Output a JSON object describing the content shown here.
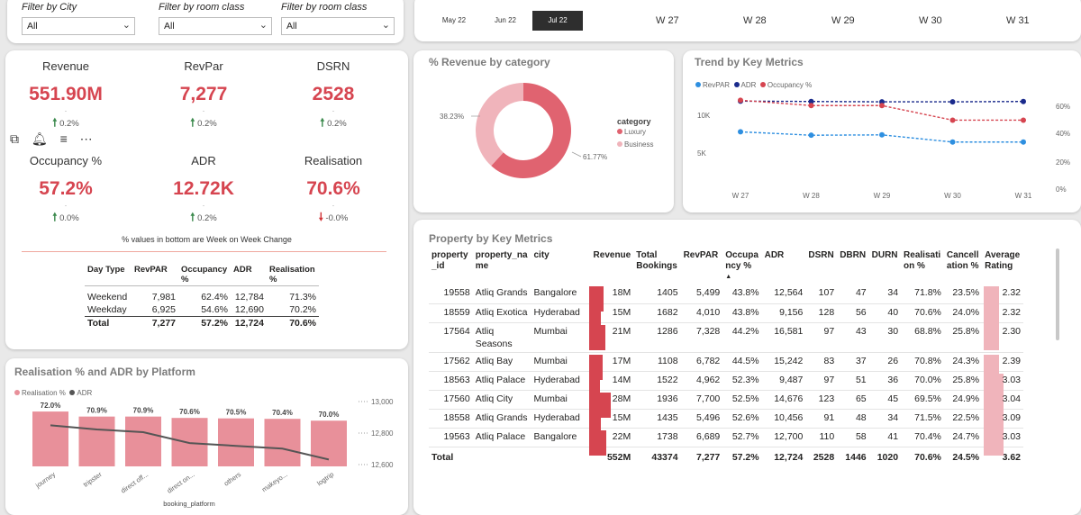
{
  "filters": [
    {
      "label": "Filter by City",
      "value": "All"
    },
    {
      "label": "Filter by room class",
      "value": "All"
    },
    {
      "label": "Filter by room class",
      "value": "All"
    }
  ],
  "date_slicer": {
    "months": [
      "May 22",
      "Jun 22",
      "Jul 22"
    ],
    "selected_month": "Jul 22",
    "weeks": [
      "W 27",
      "W 28",
      "W 29",
      "W 30",
      "W 31"
    ]
  },
  "kpis": [
    {
      "label": "Revenue",
      "value": "551.90M",
      "change": "0.2%",
      "direction": "up"
    },
    {
      "label": "RevPar",
      "value": "7,277",
      "change": "0.2%",
      "direction": "up"
    },
    {
      "label": "DSRN",
      "value": "2528",
      "change": "0.2%",
      "direction": "up"
    },
    {
      "label": "Occupancy %",
      "value": "57.2%",
      "change": "0.0%",
      "direction": "up"
    },
    {
      "label": "ADR",
      "value": "12.72K",
      "change": "0.2%",
      "direction": "up"
    },
    {
      "label": "Realisation",
      "value": "70.6%",
      "change": "-0.0%",
      "direction": "down"
    }
  ],
  "kpi_note": "% values in bottom are Week on Week Change",
  "day_type_table": {
    "headers": [
      "Day Type",
      "RevPAR",
      "Occupancy %",
      "ADR",
      "Realisation %"
    ],
    "rows": [
      [
        "Weekend",
        "7,981",
        "62.4%",
        "12,784",
        "71.3%"
      ],
      [
        "Weekday",
        "6,925",
        "54.6%",
        "12,690",
        "70.2%"
      ]
    ],
    "total": [
      "Total",
      "7,277",
      "57.2%",
      "12,724",
      "70.6%"
    ]
  },
  "revenue_by_category": {
    "title": "% Revenue by category",
    "legend_title": "category",
    "colors": {
      "Luxury": "#e06370",
      "Business": "#f0b4bb"
    }
  },
  "trend": {
    "title": "Trend by Key Metrics",
    "legend": [
      {
        "name": "RevPAR",
        "color": "#2e8fe0"
      },
      {
        "name": "ADR",
        "color": "#1a2a8c"
      },
      {
        "name": "Occupancy %",
        "color": "#d64550"
      }
    ],
    "left_ticks": [
      "10K",
      "5K"
    ],
    "right_ticks": [
      "60%",
      "40%",
      "20%",
      "0%"
    ]
  },
  "platform_chart": {
    "title": "Realisation % and ADR by Platform",
    "legend": [
      {
        "name": "Realisation %",
        "color": "#e8909a"
      },
      {
        "name": "ADR",
        "color": "#555555"
      }
    ],
    "xlabel": "booking_platform",
    "right_ticks": [
      "13,000",
      "12,800",
      "12,600"
    ]
  },
  "property_table": {
    "title": "Property by Key Metrics",
    "headers": [
      "property_id",
      "property_name",
      "city",
      "Revenue",
      "Total Bookings",
      "RevPAR",
      "Occupancy %",
      "ADR",
      "DSRN",
      "DBRN",
      "DURN",
      "Realisation %",
      "Cancellation %",
      "Average Rating"
    ],
    "header_display": [
      "property\n_id",
      "property_na\nme",
      "city",
      "Revenue",
      "Total\nBookings",
      "RevPAR",
      "Occupa\nncy %",
      "ADR",
      "DSRN",
      "DBRN",
      "DURN",
      "Realisati\non %",
      "Cancell\nation %",
      "Average\nRating"
    ],
    "rows": [
      {
        "property_id": "19558",
        "property_name": "Atliq Grands",
        "city": "Bangalore",
        "revenue": "18M",
        "revenue_value": 18,
        "total_bookings": "1405",
        "revpar": "5,499",
        "occupancy": "43.8%",
        "adr": "12,564",
        "dsrn": "107",
        "dbrn": "47",
        "durn": "34",
        "realisation": "71.8%",
        "cancellation": "23.5%",
        "rating": "2.32",
        "rating_value": 2.32
      },
      {
        "property_id": "18559",
        "property_name": "Atliq Exotica",
        "city": "Hyderabad",
        "revenue": "15M",
        "revenue_value": 15,
        "total_bookings": "1682",
        "revpar": "4,010",
        "occupancy": "43.8%",
        "adr": "9,156",
        "dsrn": "128",
        "dbrn": "56",
        "durn": "40",
        "realisation": "70.6%",
        "cancellation": "24.0%",
        "rating": "2.32",
        "rating_value": 2.32
      },
      {
        "property_id": "17564",
        "property_name": "Atliq Seasons",
        "city": "Mumbai",
        "revenue": "21M",
        "revenue_value": 21,
        "total_bookings": "1286",
        "revpar": "7,328",
        "occupancy": "44.2%",
        "adr": "16,581",
        "dsrn": "97",
        "dbrn": "43",
        "durn": "30",
        "realisation": "68.8%",
        "cancellation": "25.8%",
        "rating": "2.30",
        "rating_value": 2.3
      },
      {
        "property_id": "17562",
        "property_name": "Atliq Bay",
        "city": "Mumbai",
        "revenue": "17M",
        "revenue_value": 17,
        "total_bookings": "1108",
        "revpar": "6,782",
        "occupancy": "44.5%",
        "adr": "15,242",
        "dsrn": "83",
        "dbrn": "37",
        "durn": "26",
        "realisation": "70.8%",
        "cancellation": "24.3%",
        "rating": "2.39",
        "rating_value": 2.39
      },
      {
        "property_id": "18563",
        "property_name": "Atliq Palace",
        "city": "Hyderabad",
        "revenue": "14M",
        "revenue_value": 14,
        "total_bookings": "1522",
        "revpar": "4,962",
        "occupancy": "52.3%",
        "adr": "9,487",
        "dsrn": "97",
        "dbrn": "51",
        "durn": "36",
        "realisation": "70.0%",
        "cancellation": "25.8%",
        "rating": "3.03",
        "rating_value": 3.03
      },
      {
        "property_id": "17560",
        "property_name": "Atliq City",
        "city": "Mumbai",
        "revenue": "28M",
        "revenue_value": 28,
        "total_bookings": "1936",
        "revpar": "7,700",
        "occupancy": "52.5%",
        "adr": "14,676",
        "dsrn": "123",
        "dbrn": "65",
        "durn": "45",
        "realisation": "69.5%",
        "cancellation": "24.9%",
        "rating": "3.04",
        "rating_value": 3.04
      },
      {
        "property_id": "18558",
        "property_name": "Atliq Grands",
        "city": "Hyderabad",
        "revenue": "15M",
        "revenue_value": 15,
        "total_bookings": "1435",
        "revpar": "5,496",
        "occupancy": "52.6%",
        "adr": "10,456",
        "dsrn": "91",
        "dbrn": "48",
        "durn": "34",
        "realisation": "71.5%",
        "cancellation": "22.5%",
        "rating": "3.09",
        "rating_value": 3.09
      },
      {
        "property_id": "19563",
        "property_name": "Atliq Palace",
        "city": "Bangalore",
        "revenue": "22M",
        "revenue_value": 22,
        "total_bookings": "1738",
        "revpar": "6,689",
        "occupancy": "52.7%",
        "adr": "12,700",
        "dsrn": "110",
        "dbrn": "58",
        "durn": "41",
        "realisation": "70.4%",
        "cancellation": "24.7%",
        "rating": "3.03",
        "rating_value": 3.03
      }
    ],
    "total": {
      "label": "Total",
      "revenue": "552M",
      "total_bookings": "43374",
      "revpar": "7,277",
      "occupancy": "57.2%",
      "adr": "12,724",
      "dsrn": "2528",
      "dbrn": "1446",
      "durn": "1020",
      "realisation": "70.6%",
      "cancellation": "24.5%",
      "rating": "3.62"
    }
  },
  "chart_data": [
    {
      "type": "pie",
      "title": "% Revenue by category",
      "categories": [
        "Luxury",
        "Business"
      ],
      "values": [
        61.77,
        38.23
      ],
      "value_labels": [
        "61.77%",
        "38.23%"
      ],
      "legend_title": "category",
      "legend_position": "right"
    },
    {
      "type": "line",
      "title": "Trend by Key Metrics",
      "categories": [
        "W 27",
        "W 28",
        "W 29",
        "W 30",
        "W 31"
      ],
      "series": [
        {
          "name": "RevPAR",
          "axis": "left",
          "values": [
            8400,
            7900,
            7950,
            6900,
            6900
          ]
        },
        {
          "name": "ADR",
          "axis": "left",
          "values": [
            12900,
            12850,
            12800,
            12800,
            12850
          ]
        },
        {
          "name": "Occupancy %",
          "axis": "right",
          "values": [
            67,
            63,
            63,
            52,
            52
          ]
        }
      ],
      "ylim_left": [
        0,
        14000
      ],
      "ylim_right": [
        0,
        72
      ],
      "legend_position": "top-left"
    },
    {
      "type": "bar",
      "title": "Realisation % and ADR by Platform",
      "categories": [
        "journey",
        "tripster",
        "direct off...",
        "direct on...",
        "others",
        "makeyo...",
        "logtrip"
      ],
      "series": [
        {
          "name": "Realisation %",
          "values": [
            72.0,
            70.9,
            70.9,
            70.6,
            70.5,
            70.4,
            70.0
          ],
          "labels": [
            "72.0%",
            "70.9%",
            "70.9%",
            "70.6%",
            "70.5%",
            "70.4%",
            "70.0%"
          ]
        },
        {
          "name": "ADR",
          "type": "line",
          "axis": "right",
          "values": [
            12850,
            12820,
            12800,
            12720,
            12700,
            12680,
            12600
          ]
        }
      ],
      "xlabel": "booking_platform",
      "ylim_right": [
        12550,
        13050
      ],
      "legend_position": "top-left"
    }
  ]
}
